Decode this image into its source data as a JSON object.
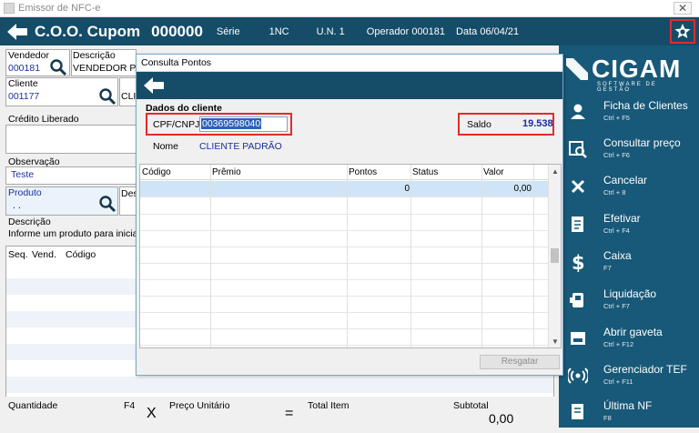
{
  "window": {
    "title": "Emissor de NFC-e",
    "close_glyph": "✕"
  },
  "header": {
    "coo_label": "C.O.O. Cupom",
    "coo_value": "000000",
    "serie_label": "Série",
    "serie_value": "1NC",
    "un_label": "U.N. 1",
    "operador_label": "Operador 000181",
    "data_label": "Data 06/04/21"
  },
  "form": {
    "vendedor_label": "Vendedor",
    "vendedor_value": "000181",
    "descricao_label": "Descrição",
    "descricao_value": "VENDEDOR PAD",
    "cliente_label": "Cliente",
    "cliente_value": "001177",
    "cliente_desc_partial": "CLI",
    "credito_label": "Crédito Liberado",
    "observacao_label": "Observação",
    "observacao_value": "Teste",
    "produto_label": "Produto",
    "produto_value": ". .",
    "produto_desc_partial": "Des",
    "descricao2_label": "Descrição",
    "descricao2_value": "Informe um produto para iniciar",
    "items_headers": [
      "Seq.",
      "Vend.",
      "Código"
    ],
    "quantidade_label": "Quantidade",
    "f4_label": "F4",
    "x_sign": "X",
    "preco_label": "Preço Unitário",
    "equals_sign": "=",
    "total_item_label": "Total Item",
    "subtotal_label": "Subtotal",
    "subtotal_value": "0,00"
  },
  "dialog": {
    "title": "Consulta Pontos",
    "section_title": "Dados do cliente",
    "cpf_label": "CPF/CNPJ",
    "cpf_value": "00369598040",
    "saldo_label": "Saldo",
    "saldo_value": "19.538",
    "nome_label": "Nome",
    "nome_value": "CLIENTE PADRÃO",
    "table": {
      "columns": [
        "Código",
        "Prêmio",
        "Pontos",
        "Status",
        "Valor"
      ],
      "rows": [
        {
          "codigo": "",
          "premio": "",
          "pontos": "0",
          "status": "",
          "valor": "0,00"
        }
      ]
    },
    "resgatar_label": "Resgatar"
  },
  "sidebar": {
    "logo_text": "CIGAM",
    "logo_sub": "SOFTWARE DE GESTÃO",
    "items": [
      {
        "label": "Ficha de Clientes",
        "shortcut": "Ctrl + F5",
        "icon": "user-icon"
      },
      {
        "label": "Consultar preço",
        "shortcut": "Ctrl + F6",
        "icon": "price-search-icon"
      },
      {
        "label": "Cancelar",
        "shortcut": "Ctrl + 8",
        "icon": "close-icon"
      },
      {
        "label": "Efetivar",
        "shortcut": "Ctrl + F4",
        "icon": "document-check-icon"
      },
      {
        "label": "Caixa",
        "shortcut": "F7",
        "icon": "dollar-icon"
      },
      {
        "label": "Liquidação",
        "shortcut": "Ctrl + F7",
        "icon": "cash-register-icon"
      },
      {
        "label": "Abrir gaveta",
        "shortcut": "Ctrl + F12",
        "icon": "drawer-icon"
      },
      {
        "label": "Gerenciador TEF",
        "shortcut": "Ctrl + F11",
        "icon": "wireless-icon"
      },
      {
        "label": "Última NF",
        "shortcut": "F8",
        "icon": "receipt-icon"
      }
    ]
  },
  "colors": {
    "header_bg": "#154c68",
    "sidebar_bg": "#185878",
    "highlight_red": "#e32b2b",
    "selected_row": "#cfe4f7",
    "link_blue": "#1a2f9e"
  }
}
